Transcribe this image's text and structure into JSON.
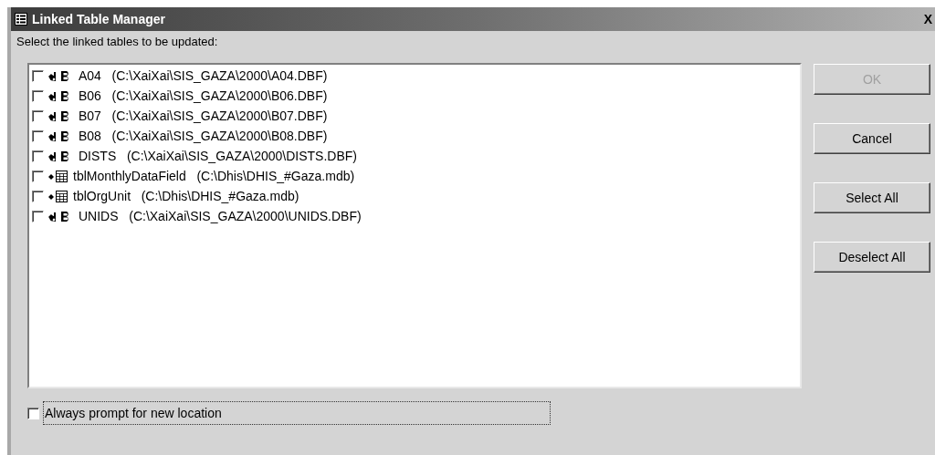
{
  "window": {
    "title": "Linked Table Manager",
    "close": "X"
  },
  "prompt": "Select the linked tables to be updated:",
  "tables": [
    {
      "name": "A04",
      "path": "(C:\\XaiXai\\SIS_GAZA\\2000\\A04.DBF)",
      "kind": "dbf",
      "checked": false
    },
    {
      "name": "B06",
      "path": "(C:\\XaiXai\\SIS_GAZA\\2000\\B06.DBF)",
      "kind": "dbf",
      "checked": false
    },
    {
      "name": "B07",
      "path": "(C:\\XaiXai\\SIS_GAZA\\2000\\B07.DBF)",
      "kind": "dbf",
      "checked": false
    },
    {
      "name": "B08",
      "path": "(C:\\XaiXai\\SIS_GAZA\\2000\\B08.DBF)",
      "kind": "dbf",
      "checked": false
    },
    {
      "name": "DISTS",
      "path": "(C:\\XaiXai\\SIS_GAZA\\2000\\DISTS.DBF)",
      "kind": "dbf",
      "checked": false
    },
    {
      "name": "tblMonthlyDataField",
      "path": "(C:\\Dhis\\DHIS_#Gaza.mdb)",
      "kind": "access",
      "checked": false
    },
    {
      "name": "tblOrgUnit",
      "path": "(C:\\Dhis\\DHIS_#Gaza.mdb)",
      "kind": "access",
      "checked": false
    },
    {
      "name": "UNIDS",
      "path": "(C:\\XaiXai\\SIS_GAZA\\2000\\UNIDS.DBF)",
      "kind": "dbf",
      "checked": false
    }
  ],
  "buttons": [
    {
      "label": "OK",
      "disabled": true
    },
    {
      "label": "Cancel",
      "disabled": false
    },
    {
      "label": "Select All",
      "disabled": false
    },
    {
      "label": "Deselect All",
      "disabled": false
    }
  ],
  "always_prompt": {
    "label": "Always prompt for new location",
    "checked": false
  }
}
